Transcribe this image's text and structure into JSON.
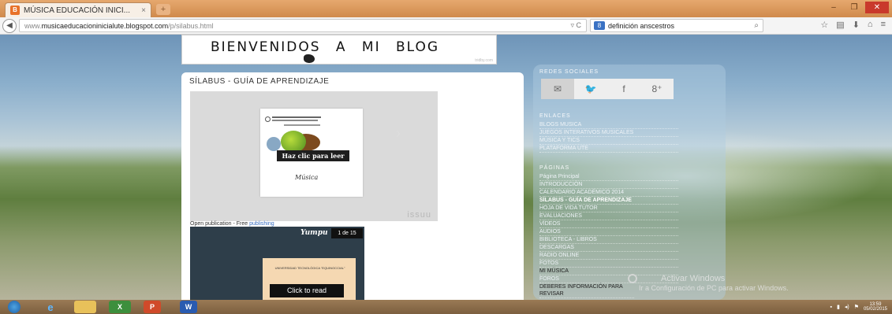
{
  "browser": {
    "tab_title": "MÚSICA EDUCACIÓN INICI...",
    "tab_close": "×",
    "new_tab": "+",
    "url_prefix": "www.",
    "url_domain": "musicaeducacioninicialute.blogspot.com",
    "url_path": "/p/silabus.html",
    "search_engine_badge": "8",
    "search_text": "definición anscestros",
    "win_min": "–",
    "win_max": "❐",
    "win_close": "✕"
  },
  "header": {
    "banner_title": "BIENVENIDOS  A  MI  BLOG",
    "banner_watermark": "tridby.com"
  },
  "post": {
    "title": "SÍLABUS - GUÍA DE APRENDIZAJE",
    "issuu_read_button": "Haz clic para leer",
    "issuu_logo": "issuu",
    "doc_script": "Música",
    "publication_text": "Open publication - Free ",
    "publication_link": "publishing",
    "yumpu_logo": "Yumpu",
    "yumpu_page": "1 de 15",
    "yumpu_doc_text": "UNIVERSIDAD TECNOLÓGICA \"EQUINOCCIAL\"",
    "yumpu_read_button": "Click to read",
    "yumpu_next": "›"
  },
  "sidebar": {
    "social_title": "REDES SOCIALES",
    "social_icons": [
      "mail-icon",
      "twitter-icon",
      "facebook-icon",
      "googleplus-icon"
    ],
    "social_glyphs": [
      "✉",
      "🐦",
      "f",
      "8⁺"
    ],
    "links_title": "ENLACES",
    "links": [
      "BLOGS MUSICA",
      "JUEGOS INTERATIVOS MUSICALES",
      "MÚSICA Y TICS",
      "PLATAFORMA UTE"
    ],
    "pages_title": "PÁGINAS",
    "pages": [
      "Página Principal",
      "INTRODUCCIÓN",
      "CALENDARIO ACADÉMICO 2014",
      "SÍLABUS - GUÍA DE APRENDIZAJE",
      "HOJA DE VIDA TUTOR",
      "EVALUACIONES",
      "VÍDEOS",
      "AUDIOS",
      "BIBLIOTECA - LIBROS",
      "DESCARGAS",
      "RADIO ONLINE",
      "FOTOS",
      "MI MÚSICA",
      "FOROS",
      "DEBERES INFORMACIÓN PARA REVISAR"
    ]
  },
  "watermark": {
    "line1": "Activar Windows",
    "line2": "Ir a Configuración de PC para activar Windows."
  },
  "taskbar": {
    "time": "13:59",
    "date": "05/02/2015"
  }
}
